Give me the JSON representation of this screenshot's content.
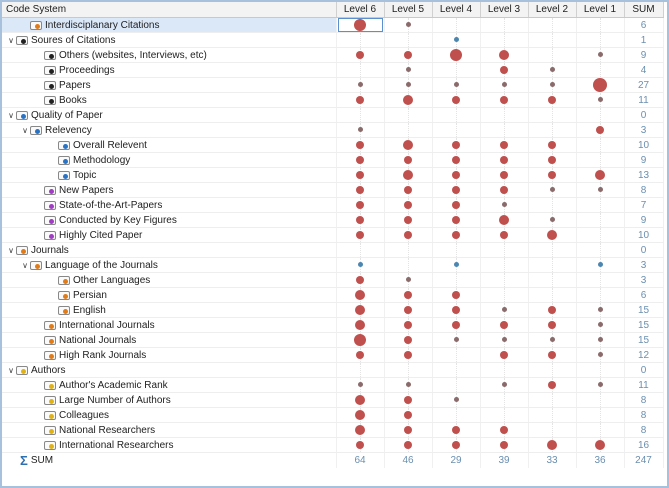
{
  "header": {
    "code_system": "Code System",
    "levels": [
      "Level 6",
      "Level 5",
      "Level 4",
      "Level 3",
      "Level 2",
      "Level 1"
    ],
    "sum": "SUM"
  },
  "colors": {
    "dot": "#c0504d",
    "blue_dot": "#4a86b0",
    "selection": "#dbe8f8"
  },
  "rows": [
    {
      "label": "Interdisciplanary Citations",
      "indent": 1,
      "toggle": "",
      "icon": "#e07b1a",
      "dots": [
        4,
        1,
        0,
        0,
        0,
        0
      ],
      "sum": "6",
      "selected": true
    },
    {
      "label": "Soures of Citations",
      "indent": 0,
      "toggle": "v",
      "icon": "#222222",
      "dots": [
        0,
        0,
        "b",
        0,
        0,
        0
      ],
      "sum": "1"
    },
    {
      "label": "Others (websites, Interviews, etc)",
      "indent": 2,
      "toggle": "",
      "icon": "#222222",
      "dots": [
        2,
        2,
        4,
        3,
        0,
        1
      ],
      "sum": "9"
    },
    {
      "label": "Proceedings",
      "indent": 2,
      "toggle": "",
      "icon": "#222222",
      "dots": [
        0,
        1,
        0,
        2,
        1,
        0
      ],
      "sum": "4"
    },
    {
      "label": "Papers",
      "indent": 2,
      "toggle": "",
      "icon": "#222222",
      "dots": [
        1,
        1,
        1,
        1,
        1,
        5
      ],
      "sum": "27"
    },
    {
      "label": "Books",
      "indent": 2,
      "toggle": "",
      "icon": "#222222",
      "dots": [
        2,
        3,
        2,
        2,
        2,
        1
      ],
      "sum": "11"
    },
    {
      "label": "Quality of Paper",
      "indent": 0,
      "toggle": "v",
      "icon": "#2a72c4",
      "dots": [
        0,
        0,
        0,
        0,
        0,
        0
      ],
      "sum": "0"
    },
    {
      "label": "Relevency",
      "indent": 1,
      "toggle": "v",
      "icon": "#2a72c4",
      "dots": [
        1,
        0,
        0,
        0,
        0,
        2
      ],
      "sum": "3"
    },
    {
      "label": "Overall Relevent",
      "indent": 3,
      "toggle": "",
      "icon": "#2a72c4",
      "dots": [
        2,
        3,
        2,
        2,
        2,
        0
      ],
      "sum": "10"
    },
    {
      "label": "Methodology",
      "indent": 3,
      "toggle": "",
      "icon": "#2a72c4",
      "dots": [
        2,
        2,
        2,
        2,
        2,
        0
      ],
      "sum": "9"
    },
    {
      "label": "Topic",
      "indent": 3,
      "toggle": "",
      "icon": "#2a72c4",
      "dots": [
        2,
        3,
        2,
        2,
        2,
        3
      ],
      "sum": "13"
    },
    {
      "label": "New Papers",
      "indent": 2,
      "toggle": "",
      "icon": "#a13cc4",
      "dots": [
        2,
        2,
        2,
        2,
        1,
        1
      ],
      "sum": "8"
    },
    {
      "label": "State-of-the-Art-Papers",
      "indent": 2,
      "toggle": "",
      "icon": "#a13cc4",
      "dots": [
        2,
        2,
        2,
        1,
        0,
        0
      ],
      "sum": "7"
    },
    {
      "label": "Conducted by Key Figures",
      "indent": 2,
      "toggle": "",
      "icon": "#a13cc4",
      "dots": [
        2,
        2,
        2,
        3,
        1,
        0
      ],
      "sum": "9"
    },
    {
      "label": "Highly Cited Paper",
      "indent": 2,
      "toggle": "",
      "icon": "#a13cc4",
      "dots": [
        2,
        2,
        2,
        2,
        3,
        0
      ],
      "sum": "10"
    },
    {
      "label": "Journals",
      "indent": 0,
      "toggle": "v",
      "icon": "#e07b1a",
      "dots": [
        0,
        0,
        0,
        0,
        0,
        0
      ],
      "sum": "0"
    },
    {
      "label": "Language of the Journals",
      "indent": 1,
      "toggle": "v",
      "icon": "#e07b1a",
      "dots": [
        "b",
        0,
        "b",
        0,
        0,
        "b"
      ],
      "sum": "3"
    },
    {
      "label": "Other Languages",
      "indent": 3,
      "toggle": "",
      "icon": "#e07b1a",
      "dots": [
        2,
        1,
        0,
        0,
        0,
        0
      ],
      "sum": "3"
    },
    {
      "label": "Persian",
      "indent": 3,
      "toggle": "",
      "icon": "#e07b1a",
      "dots": [
        3,
        2,
        2,
        0,
        0,
        0
      ],
      "sum": "6"
    },
    {
      "label": "English",
      "indent": 3,
      "toggle": "",
      "icon": "#e07b1a",
      "dots": [
        3,
        2,
        2,
        1,
        2,
        1
      ],
      "sum": "15"
    },
    {
      "label": "International Journals",
      "indent": 2,
      "toggle": "",
      "icon": "#e07b1a",
      "dots": [
        3,
        2,
        2,
        2,
        2,
        1
      ],
      "sum": "15"
    },
    {
      "label": "National Journals",
      "indent": 2,
      "toggle": "",
      "icon": "#e07b1a",
      "dots": [
        4,
        2,
        1,
        1,
        1,
        1
      ],
      "sum": "15"
    },
    {
      "label": "High Rank Journals",
      "indent": 2,
      "toggle": "",
      "icon": "#e07b1a",
      "dots": [
        2,
        2,
        0,
        2,
        2,
        1
      ],
      "sum": "12"
    },
    {
      "label": "Authors",
      "indent": 0,
      "toggle": "v",
      "icon": "#e0b21a",
      "dots": [
        0,
        0,
        0,
        0,
        0,
        0
      ],
      "sum": "0"
    },
    {
      "label": "Author's Academic Rank",
      "indent": 2,
      "toggle": "",
      "icon": "#e0b21a",
      "dots": [
        1,
        1,
        0,
        1,
        2,
        1
      ],
      "sum": "11"
    },
    {
      "label": "Large Number of Authors",
      "indent": 2,
      "toggle": "",
      "icon": "#e0b21a",
      "dots": [
        3,
        2,
        1,
        0,
        0,
        0
      ],
      "sum": "8"
    },
    {
      "label": "Colleagues",
      "indent": 2,
      "toggle": "",
      "icon": "#e0b21a",
      "dots": [
        3,
        2,
        0,
        0,
        0,
        0
      ],
      "sum": "8"
    },
    {
      "label": "National Researchers",
      "indent": 2,
      "toggle": "",
      "icon": "#e0b21a",
      "dots": [
        3,
        2,
        2,
        2,
        0,
        0
      ],
      "sum": "8"
    },
    {
      "label": "International Researchers",
      "indent": 2,
      "toggle": "",
      "icon": "#e0b21a",
      "dots": [
        2,
        2,
        2,
        2,
        3,
        3
      ],
      "sum": "16"
    }
  ],
  "sum_row": {
    "label": "SUM",
    "values": [
      "64",
      "46",
      "29",
      "39",
      "33",
      "36",
      "247"
    ]
  }
}
